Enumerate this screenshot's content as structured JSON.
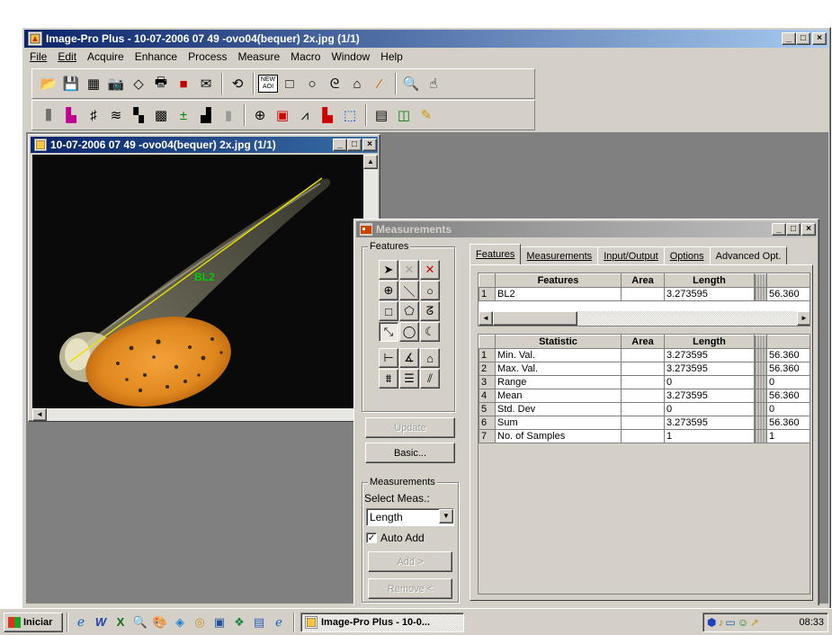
{
  "app": {
    "title": "Image-Pro Plus - 10-07-2006 07 49 -ovo04(bequer) 2x.jpg (1/1)",
    "menu": [
      "File",
      "Edit",
      "Acquire",
      "Enhance",
      "Process",
      "Measure",
      "Macro",
      "Window",
      "Help"
    ],
    "toolbar_row1": [
      "folder-open-icon",
      "save-icon",
      "grid-icon",
      "camera-icon",
      "eraser-icon",
      "print-icon",
      "book-icon",
      "envelope-icon",
      "undo-icon",
      "new-aoi-icon",
      "rectangle-tool-icon",
      "ellipse-tool-icon",
      "freeform-tool-icon",
      "house-icon",
      "wand-icon",
      "magnify-icon",
      "hand-icon"
    ],
    "toolbar_row1_new_aoi_label": "NEW AOI",
    "toolbar_row2": [
      "equalize-icon",
      "histogram-icon",
      "grid-lines-icon",
      "layers-icon",
      "tiles-icon",
      "pattern-icon",
      "count-icon",
      "chart-icon",
      "bars-icon",
      "palette-icon",
      "overlay-icon",
      "ruler-icon",
      "bar-chart-icon",
      "line-chart-icon",
      "calculator-icon",
      "database-icon",
      "pencil-chart-icon"
    ]
  },
  "image_window": {
    "title": "10-07-2006 07 49 -ovo04(bequer) 2x.jpg (1/1)",
    "label_text": "BL2",
    "line_color": "#e8e000",
    "label_color": "#00cc00"
  },
  "measurements_window": {
    "title": "Measurements",
    "features_group_label": "Features",
    "tools": [
      "pointer-icon",
      "delete-gray-icon",
      "delete-red-icon",
      "crosshair-icon",
      "line-tool-icon",
      "circle-tool-icon",
      "rect-tool-icon",
      "polygon-tool-icon",
      "trace-tool-icon",
      "freeline-tool-icon",
      "oval-tool-icon",
      "arc-tool-icon",
      "hline-tool-icon",
      "angle-tool-icon",
      "area-tool-icon",
      "calipers-tool-icon",
      "stack-tool-icon",
      "thickness-tool-icon"
    ],
    "update_label": "Update",
    "basic_label": "Basic...",
    "measurements_group_label": "Measurements",
    "select_meas_label": "Select Meas.:",
    "select_value": "Length",
    "auto_add_label": "Auto Add",
    "auto_add_checked": true,
    "add_label": "Add >",
    "remove_label": "Remove <",
    "tabs": [
      "Features",
      "Measurements",
      "Input/Output",
      "Options",
      "Advanced Opt."
    ],
    "features_table": {
      "headers": [
        "Features",
        "Area",
        "Length",
        "/"
      ],
      "rows": [
        {
          "num": "1",
          "name": "BL2",
          "area": "",
          "length": "3.273595",
          "extra": "56.360"
        }
      ]
    },
    "stats_table": {
      "headers": [
        "Statistic",
        "Area",
        "Length",
        "/"
      ],
      "rows": [
        {
          "num": "1",
          "name": "Min. Val.",
          "area": "",
          "length": "3.273595",
          "extra": "56.360"
        },
        {
          "num": "2",
          "name": "Max. Val.",
          "area": "",
          "length": "3.273595",
          "extra": "56.360"
        },
        {
          "num": "3",
          "name": "Range",
          "area": "",
          "length": "0",
          "extra": "0"
        },
        {
          "num": "4",
          "name": "Mean",
          "area": "",
          "length": "3.273595",
          "extra": "56.360"
        },
        {
          "num": "5",
          "name": "Std. Dev",
          "area": "",
          "length": "0",
          "extra": "0"
        },
        {
          "num": "6",
          "name": "Sum",
          "area": "",
          "length": "3.273595",
          "extra": "56.360"
        },
        {
          "num": "7",
          "name": "No. of Samples",
          "area": "",
          "length": "1",
          "extra": "1"
        }
      ]
    }
  },
  "taskbar": {
    "start_label": "Iniciar",
    "quick_launch": [
      "ie-icon",
      "word-icon",
      "excel-icon",
      "search-icon",
      "paint-icon",
      "explorer-icon",
      "find-icon",
      "media-icon",
      "network-icon",
      "window-icon",
      "browser-icon"
    ],
    "task_label": "Image-Pro Plus - 10-0...",
    "tray_icons": [
      "tray-network-icon",
      "tray-speaker-icon",
      "tray-monitor-icon",
      "tray-user-icon",
      "tray-arrow-icon"
    ],
    "clock": "08:33"
  }
}
